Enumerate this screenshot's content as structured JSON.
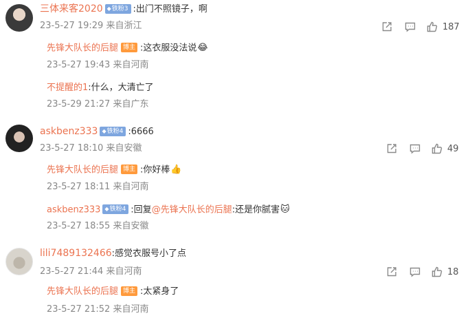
{
  "comments": [
    {
      "user": "三体来客2020",
      "fan_badge": "铁粉3",
      "text": ":出门不照镜子，啊",
      "time": "23-5-27 19:29",
      "location": "来自浙江",
      "likes": "187",
      "replies": [
        {
          "user": "先锋大队长的后腿",
          "owner_badge": "博主",
          "text": ":这衣服没法说",
          "emoji": "laughing-crying-emoji",
          "time": "23-5-27 19:43",
          "location": "来自河南"
        },
        {
          "user": "不提醒的1",
          "text": ":什么，大清亡了",
          "time": "23-5-29 21:27",
          "location": "来自广东"
        }
      ]
    },
    {
      "user": "askbenz333",
      "fan_badge": "铁粉4",
      "text": ":6666",
      "time": "23-5-27 18:10",
      "location": "来自安徽",
      "likes": "49",
      "replies": [
        {
          "user": "先锋大队长的后腿",
          "owner_badge": "博主",
          "text": ":你好棒",
          "emoji": "thumbs-up-emoji",
          "time": "23-5-27 18:11",
          "location": "来自河南"
        },
        {
          "user": "askbenz333",
          "fan_badge": "铁粉4",
          "text_prefix": ":回复",
          "mention": "@先锋大队长的后腿",
          "text": ":还是你腻害",
          "emoji": "cat-emoji",
          "time": "23-5-27 18:55",
          "location": "来自安徽"
        }
      ]
    },
    {
      "user": "lili7489132466",
      "text": ":感觉衣服号小了点",
      "time": "23-5-27 21:44",
      "location": "来自河南",
      "likes": "18",
      "replies": [
        {
          "user": "先锋大队长的后腿",
          "owner_badge": "博主",
          "text": ":太紧身了",
          "time": "23-5-27 21:52",
          "location": "来自河南"
        }
      ]
    }
  ],
  "icons": {
    "share": "share-icon",
    "comment": "comment-icon",
    "like": "thumbs-up-icon"
  },
  "colors": {
    "username": "#eb7350",
    "fan_badge": "#7ea6df",
    "owner_badge": "#ff9a3c",
    "meta": "#888888"
  }
}
